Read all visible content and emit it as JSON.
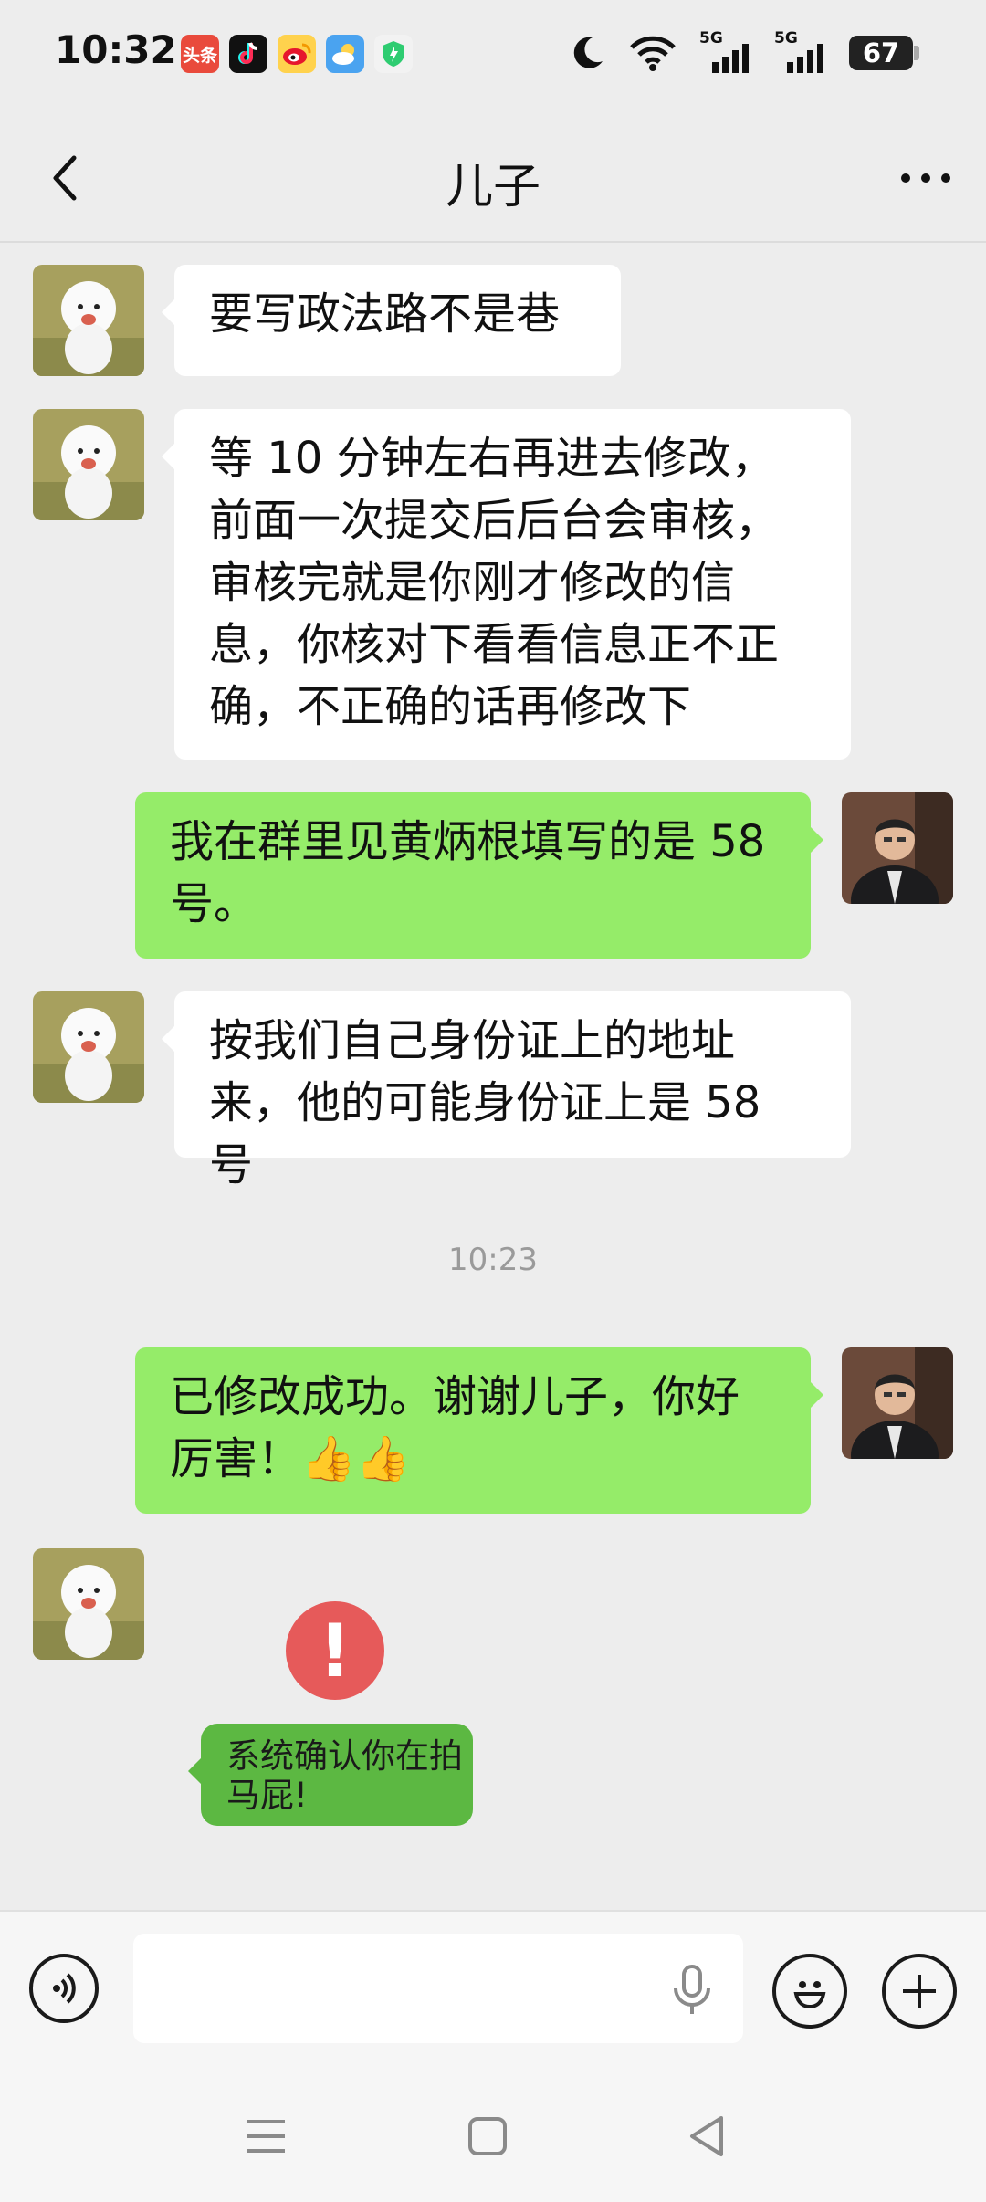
{
  "status_bar": {
    "time": "10:32",
    "app_icons": [
      "toutiao-icon",
      "douyin-icon",
      "weibo-icon",
      "weather-icon",
      "security-icon"
    ],
    "toutiao_label": "头条",
    "signal1_label": "5G",
    "signal2_label": "5G",
    "battery": "67"
  },
  "header": {
    "title": "儿子"
  },
  "messages": [
    {
      "side": "left",
      "text": "要写政法路不是巷"
    },
    {
      "side": "left",
      "text": "等 10 分钟左右再进去修改，前面一次提交后后台会审核，审核完就是你刚才修改的信息，你核对下看看信息正不正确，不正确的话再修改下"
    },
    {
      "side": "right",
      "text": "我在群里见黄炳根填写的是 58 号。"
    },
    {
      "side": "left",
      "text": "按我们自己身份证上的地址来，他的可能身份证上是 58 号"
    },
    {
      "side": "right",
      "text": "已修改成功。谢谢儿子，你好厉害！👍👍"
    }
  ],
  "timestamp": "10:23",
  "overlay": {
    "alert_mark": "!",
    "text": "系统确认你在拍马屁!"
  },
  "input_bar": {
    "placeholder": ""
  },
  "colors": {
    "background": "#ededed",
    "bubble_received": "#ffffff",
    "bubble_sent": "#95ec69",
    "alert_red": "#e65a5a",
    "overlay_green": "#5cb842"
  }
}
